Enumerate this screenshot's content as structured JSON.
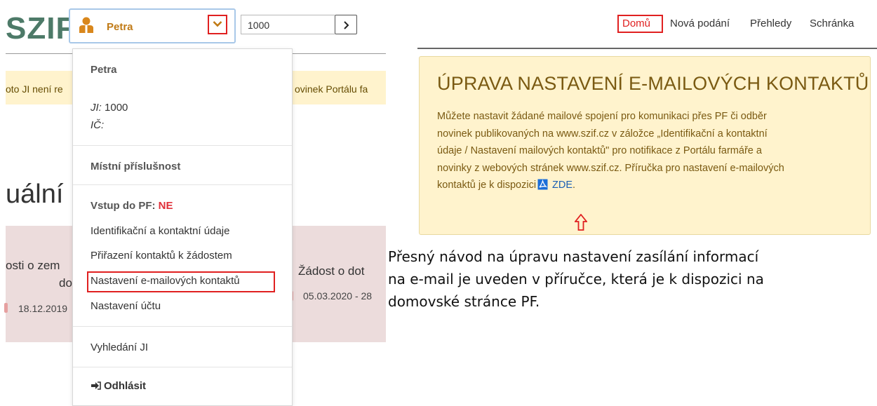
{
  "header": {
    "logo": "SZIF",
    "user_name": "Petra",
    "ji_value": "1000"
  },
  "alert": {
    "left_text": "oto JI není re",
    "right_text": "ovinek Portálu fa"
  },
  "heading_partial": "uální",
  "cards": [
    {
      "line1": "osti o zem",
      "line2": "do",
      "date": "18.12.2019"
    },
    {
      "line1": "Žádost o dot",
      "date": "05.03.2020 - 28"
    }
  ],
  "dropdown": {
    "name": "Petra",
    "ji_label": "JI:",
    "ji_value": "1000",
    "ic_label": "IČ:",
    "mistni": "Místní příslušnost",
    "vstup_label": "Vstup do PF:",
    "vstup_value": "NE",
    "items": [
      "Identifikační a kontaktní údaje",
      "Přiřazení kontaktů k žádostem",
      "Nastavení e-mailových kontaktů",
      "Nastavení účtu"
    ],
    "vyhledani": "Vyhledání JI",
    "logout": "Odhlásit"
  },
  "nav": {
    "home": "Domů",
    "new": "Nová podání",
    "reviews": "Přehledy",
    "inbox": "Schránka"
  },
  "notice": {
    "title": "ÚPRAVA NASTAVENÍ E-MAILOVÝCH KONTAKTŮ",
    "line1": "Můžete nastavit žádané mailové spojení pro komunikaci přes PF či odběr",
    "line2": "novinek publikovaných na www.szif.cz v záložce „Identifikační a kontaktní",
    "line3": "údaje / Nastavení mailových kontaktů\" pro notifikace z Portálu farmáře a",
    "line4": "novinky z webových stránek www.szif.cz. Příručka pro nastavení e-mailových",
    "line5": "kontaktů je k dispozici",
    "link": "ZDE",
    "link_after": "."
  },
  "guide": {
    "line1": "Přesný návod na úpravu nastavení zasílání informací",
    "line2": "na e-mail je uveden v příručce, která je k dispozici na",
    "line3": "domovské stránce PF."
  },
  "colors": {
    "logo": "#4d7a68",
    "user_name": "#c07a15",
    "highlight_border": "#e02020",
    "alert_bg": "#fff3cd",
    "card_bg": "#ecdcdc",
    "link": "#1a5fb4"
  },
  "icons": [
    "user-icon",
    "chevron-down-icon",
    "chevron-right-icon",
    "logout-icon",
    "pdf-icon",
    "arrow-up-icon"
  ]
}
